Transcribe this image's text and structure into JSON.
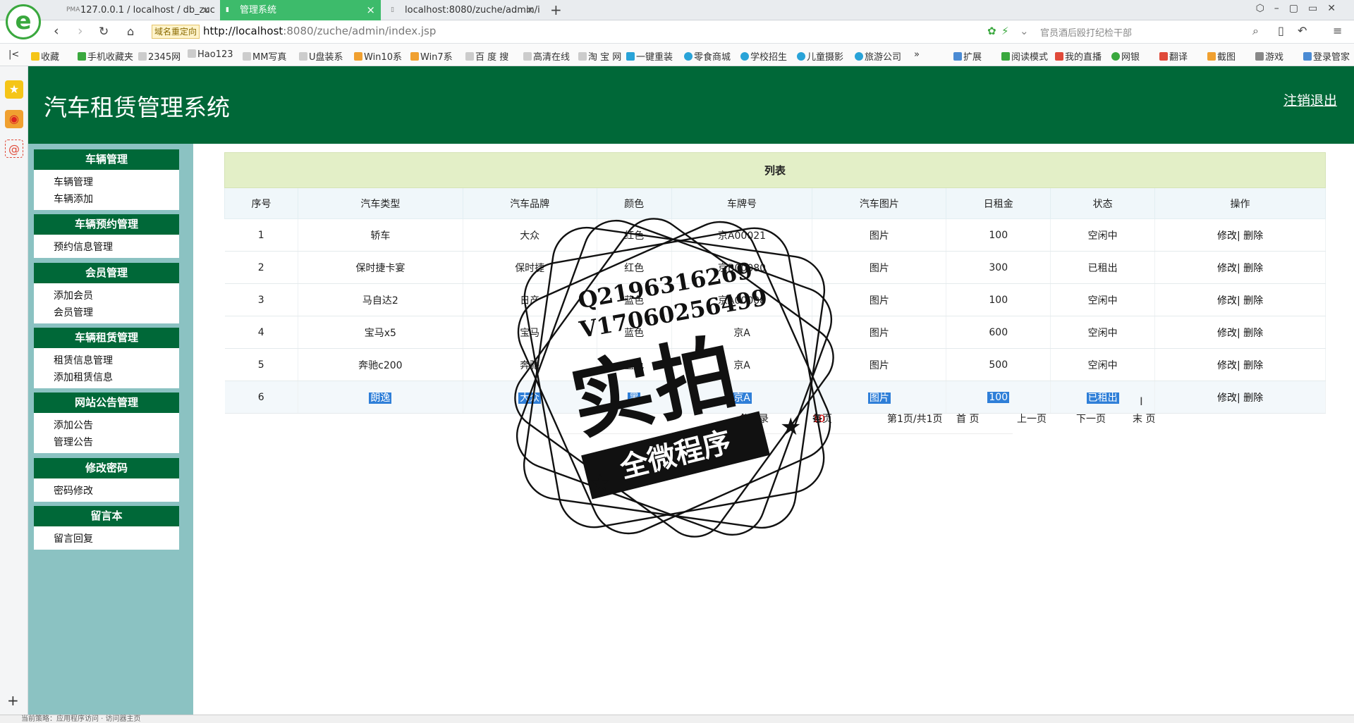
{
  "browser": {
    "tabs": [
      {
        "label": "127.0.0.1 / localhost / db_zuc",
        "favicon": "PMA"
      },
      {
        "label": "管理系统"
      },
      {
        "label": "localhost:8080/zuche/admin/i"
      }
    ],
    "redirect_tag": "域名重定向",
    "url_host": "http://localhost",
    "url_rest": ":8080/zuche/admin/index.jsp",
    "search_placeholder": "官员酒后殴打纪检干部",
    "bookmarks": [
      "收藏",
      "手机收藏夹",
      "2345网",
      "Hao123",
      "MM写真",
      "U盘装系",
      "Win10系",
      "Win7系",
      "百 度 搜",
      "高清在线",
      "淘 宝 网",
      "一键重装",
      "零食商城",
      "学校招生",
      "儿童摄影",
      "旅游公司",
      "»",
      "扩展",
      "阅读模式",
      "我的直播",
      "网银",
      "翻译",
      "截图",
      "游戏",
      "登录管家"
    ],
    "status_text": "当前策略：应用程序访问 · 访问器主页"
  },
  "app": {
    "title": "汽车租赁管理系统",
    "logout": "注销退出"
  },
  "sidebar": [
    {
      "title": "车辆管理",
      "links": [
        "车辆管理",
        "车辆添加"
      ]
    },
    {
      "title": "车辆预约管理",
      "links": [
        "预约信息管理"
      ]
    },
    {
      "title": "会员管理",
      "links": [
        "添加会员",
        "会员管理"
      ]
    },
    {
      "title": "车辆租赁管理",
      "links": [
        "租赁信息管理",
        "添加租赁信息"
      ]
    },
    {
      "title": "网站公告管理",
      "links": [
        "添加公告",
        "管理公告"
      ]
    },
    {
      "title": "修改密码",
      "links": [
        "密码修改"
      ]
    },
    {
      "title": "留言本",
      "links": [
        "留言回复"
      ]
    }
  ],
  "table": {
    "caption": "列表",
    "headers": [
      "序号",
      "汽车类型",
      "汽车品牌",
      "颜色",
      "车牌号",
      "汽车图片",
      "日租金",
      "状态",
      "操作"
    ],
    "rows": [
      [
        "1",
        "轿车",
        "大众",
        "红色",
        "京A00021",
        "图片",
        "100",
        "空闲中"
      ],
      [
        "2",
        "保时捷卡宴",
        "保时捷",
        "红色",
        "京B00080",
        "图片",
        "300",
        "已租出"
      ],
      [
        "3",
        "马自达2",
        "日产",
        "蓝色",
        "京A00008",
        "图片",
        "100",
        "空闲中"
      ],
      [
        "4",
        "宝马x5",
        "宝马",
        "蓝色",
        "京A",
        "图片",
        "600",
        "空闲中"
      ],
      [
        "5",
        "奔驰c200",
        "奔驰",
        "蓝色",
        "京A",
        "图片",
        "500",
        "空闲中"
      ],
      [
        "6",
        "朗逸",
        "大众",
        "黑",
        "京A",
        "图片",
        "100",
        "已租出"
      ]
    ],
    "edit_label": "修改|",
    "delete_label": "删除"
  },
  "pager": {
    "total_prefix": "共",
    "total": "6",
    "total_suffix": "条记录",
    "per_prefix": "每页",
    "per_page": "10",
    "per_suffix": "条",
    "page_text": "第1页/共1页",
    "first": "首  页",
    "prev": "上一页",
    "next": "下一页",
    "last": "末  页"
  },
  "watermark": {
    "line1": "Q2196316269",
    "line2": "V17060256499",
    "big": "实拍",
    "ribbon": "全微程序"
  }
}
